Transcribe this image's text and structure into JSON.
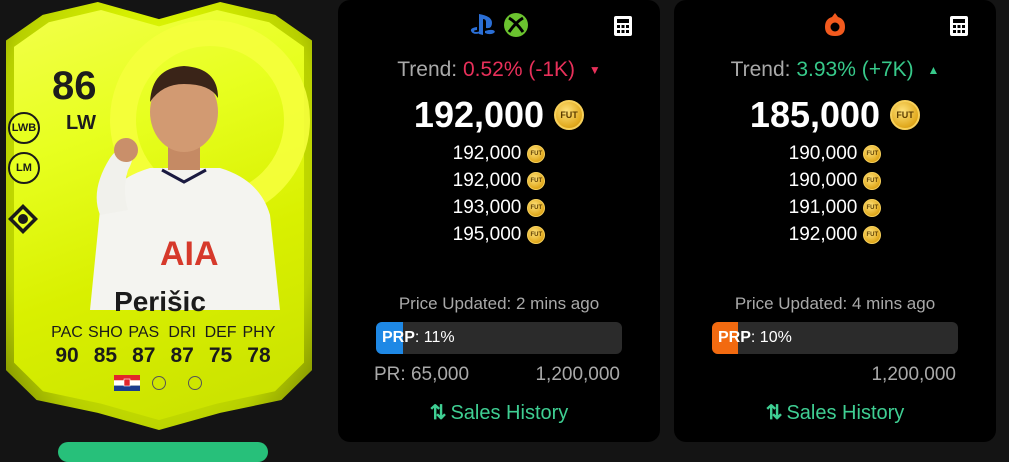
{
  "player": {
    "rating": "86",
    "position": "LW",
    "alt_positions": [
      "LWB",
      "LM"
    ],
    "name": "Perišic",
    "stat_labels": [
      "PAC",
      "SHO",
      "PAS",
      "DRI",
      "DEF",
      "PHY"
    ],
    "stat_values": [
      "90",
      "85",
      "87",
      "87",
      "75",
      "78"
    ],
    "nation": "Croatia",
    "card_color": "#e7ff1f"
  },
  "panels": {
    "console": {
      "platform_icons": [
        "playstation-icon",
        "xbox-icon"
      ],
      "trend_label": "Trend:",
      "trend_value": "0.52% (-1K)",
      "trend_direction": "down",
      "main_price": "192,000",
      "prices": [
        "192,000",
        "192,000",
        "193,000",
        "195,000"
      ],
      "updated": "Price Updated: 2 mins ago",
      "prp_label": "PRP",
      "prp_value": ": 11%",
      "prp_fraction": 0.11,
      "prp_color": "#1e88e5",
      "pr_min": "PR: 65,000",
      "pr_max": "1,200,000",
      "sales_history": "Sales History"
    },
    "pc": {
      "platform_icons": [
        "origin-icon"
      ],
      "trend_label": "Trend:",
      "trend_value": "3.93% (+7K)",
      "trend_direction": "up",
      "main_price": "185,000",
      "prices": [
        "190,000",
        "190,000",
        "191,000",
        "192,000"
      ],
      "updated": "Price Updated: 4 mins ago",
      "prp_label": "PRP",
      "prp_value": ": 10%",
      "prp_fraction": 0.1,
      "prp_color": "#f26a10",
      "pr_min": "",
      "pr_max": "1,200,000",
      "sales_history": "Sales History"
    }
  },
  "coin_label": "FUT",
  "colors": {
    "trend_down": "#e8305a",
    "trend_up": "#37c98a",
    "accent_green": "#3fcf93",
    "panel_bg": "#000000"
  }
}
